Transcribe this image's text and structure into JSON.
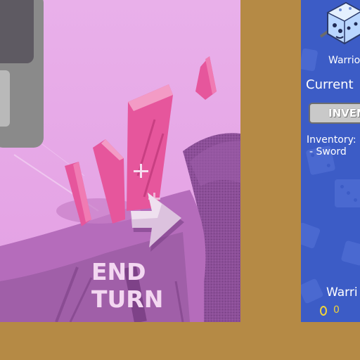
{
  "scene": {
    "end_turn_label": "END TURN"
  },
  "panel": {
    "hero_name": "Warrio",
    "current_label": "Current",
    "inventory_button_label": "INVEN",
    "inventory_title": "Inventory:",
    "inventory_item": "- Sword",
    "footer_name": "Warri",
    "gold_value": "0"
  },
  "icons": {
    "cursor": "crosshair-icon",
    "end_turn_arrow": "arrow-right-icon",
    "hero": "dice-hero-icon",
    "gold": "coin-icon"
  },
  "colors": {
    "background": "#b58a45",
    "scene_sky": "#e6a6e6",
    "crystal": "#e6569c",
    "panel": "#3c5cc6",
    "gold": "#f0d33a",
    "end_turn_text": "#f3d7f1"
  }
}
